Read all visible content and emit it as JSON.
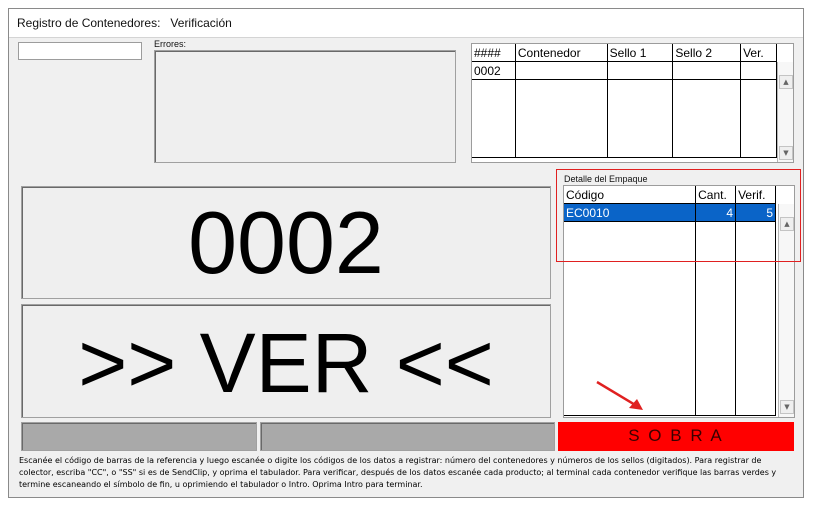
{
  "window": {
    "title": "Registro de Contenedores:   Verificación"
  },
  "scan_input": {
    "value": ""
  },
  "errors": {
    "label": "Errores:"
  },
  "containers_table": {
    "headers": [
      "####",
      "Contenedor",
      "Sello 1",
      "Sello 2",
      "Ver."
    ],
    "rows": [
      {
        "num": "0002",
        "contenedor": "",
        "sello1": "",
        "sello2": "",
        "ver": ""
      }
    ]
  },
  "big_display": {
    "number": "0002",
    "status": ">> VER <<"
  },
  "packing_detail": {
    "label": "Detalle del Empaque",
    "headers": [
      "Código",
      "Cant.",
      "Verif."
    ],
    "rows": [
      {
        "codigo": "EC0010",
        "cant": "4",
        "verif": "5"
      }
    ]
  },
  "status_bar": {
    "result": "S O B R A",
    "result_color": "#ff0000"
  },
  "help_text": "Escanée el código de barras de la referencia y luego escanée o digite los códigos de los datos a registrar: número del contenedores y números de los sellos (digitados). Para registrar de colector, escriba \"CC\", o \"SS\" si es de SendClip, y oprima el tabulador. Para verificar, después de los datos escanée cada producto; al terminal cada contenedor verifique las barras verdes y termine escaneando el símbolo de fin, u oprimiendo el tabulador o Intro. Oprima Intro para terminar.",
  "annotations": {
    "highlight_color": "#e02020",
    "arrow_color": "#e02020"
  }
}
